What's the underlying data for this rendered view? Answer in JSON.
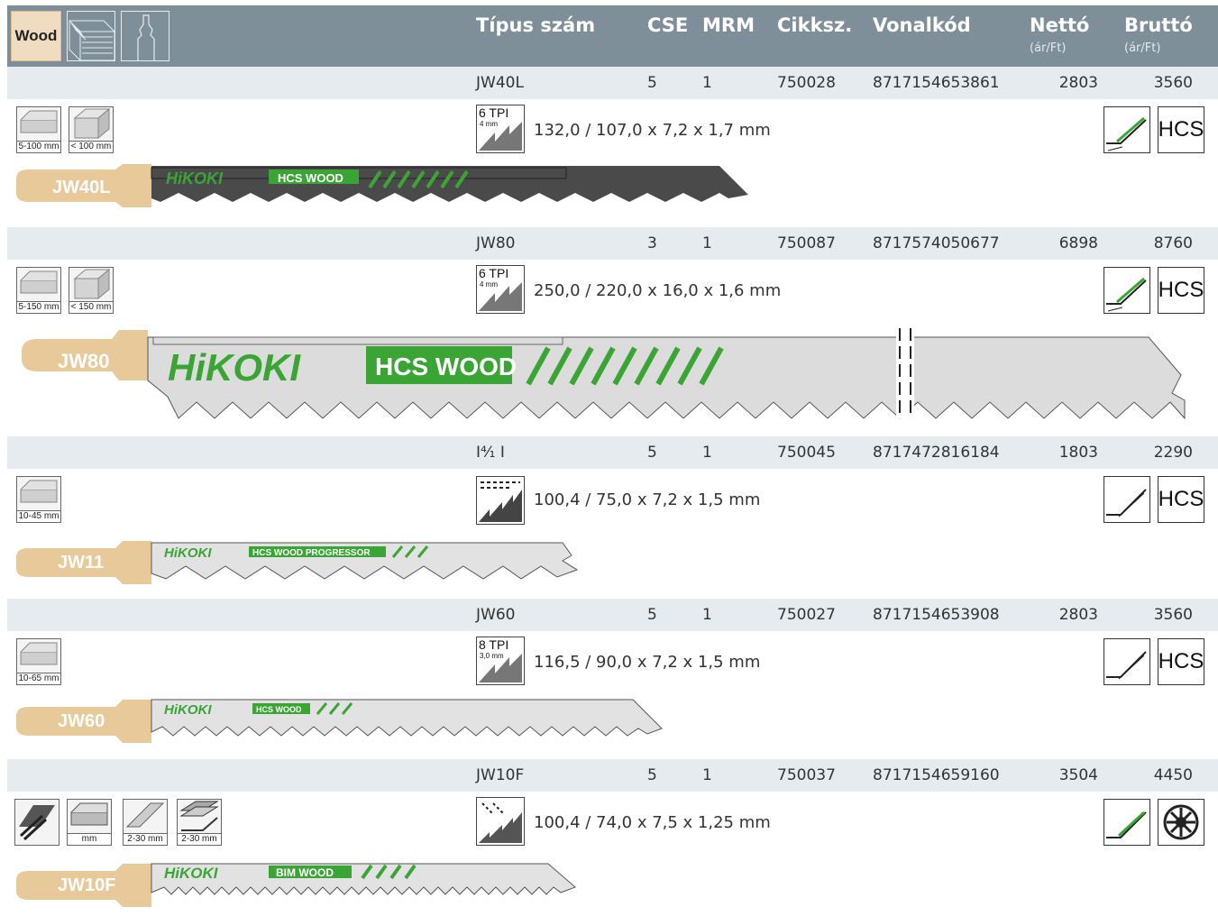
{
  "header": {
    "category": "Wood",
    "columns": {
      "type": "Típus szám",
      "cse": "CSE",
      "mrm": "MRM",
      "article": "Cikksz.",
      "barcode": "Vonalkód",
      "net": "Nettó",
      "net_unit": "(ár/Ft)",
      "gross": "Bruttó",
      "gross_unit": "(ár/Ft)"
    }
  },
  "products": [
    {
      "type": "JW40L",
      "cse": "5",
      "mrm": "1",
      "article": "750028",
      "barcode": "8717154653861",
      "net": "2803",
      "gross": "3560",
      "tpi": "6 TPI",
      "tpi_mm": "4 mm",
      "dims": "132,0 / 107,0 x 7,2 x 1,7 mm",
      "material": "HCS",
      "app_labels": [
        "5-100 mm",
        "< 100 mm"
      ],
      "blade_code": "JW40L",
      "blade_print": [
        "HiKOKI",
        "HCS WOOD"
      ]
    },
    {
      "type": "JW80",
      "cse": "3",
      "mrm": "1",
      "article": "750087",
      "barcode": "8717574050677",
      "net": "6898",
      "gross": "8760",
      "tpi": "6 TPI",
      "tpi_mm": "4 mm",
      "dims": "250,0 / 220,0 x 16,0 x 1,6 mm",
      "material": "HCS",
      "app_labels": [
        "5-150 mm",
        "< 150 mm"
      ],
      "blade_code": "JW80",
      "blade_print": [
        "HiKOKI",
        "HCS WOOD"
      ]
    },
    {
      "type": "I⁴⁄₁ I",
      "cse": "5",
      "mrm": "1",
      "article": "750045",
      "barcode": "8717472816184",
      "net": "1803",
      "gross": "2290",
      "tpi": "",
      "tpi_mm": "",
      "dims": "100,4 / 75,0 x 7,2 x 1,5 mm",
      "material": "HCS",
      "app_labels": [
        "10-45 mm"
      ],
      "blade_code": "JW11",
      "blade_print": [
        "HiKOKI",
        "HCS WOOD PROGRESSOR"
      ]
    },
    {
      "type": "JW60",
      "cse": "5",
      "mrm": "1",
      "article": "750027",
      "barcode": "8717154653908",
      "net": "2803",
      "gross": "3560",
      "tpi": "8 TPI",
      "tpi_mm": "3,0 mm",
      "dims": "116,5 / 90,0 x 7,2 x 1,5 mm",
      "material": "HCS",
      "app_labels": [
        "10-65 mm"
      ],
      "blade_code": "JW60",
      "blade_print": [
        "HiKOKI",
        "HCS WOOD"
      ]
    },
    {
      "type": "JW10F",
      "cse": "5",
      "mrm": "1",
      "article": "750037",
      "barcode": "8717154659160",
      "net": "3504",
      "gross": "4450",
      "tpi": "",
      "tpi_mm": "",
      "dims": "100,4 / 74,0 x 7,5 x 1,25 mm",
      "material": "",
      "app_labels": [
        "",
        "mm",
        "2-30 mm",
        "2-30 mm"
      ],
      "blade_code": "JW10F",
      "blade_print": [
        "HiKOKI",
        "BIM WOOD"
      ]
    }
  ],
  "colors": {
    "header_bg": "#7f8f99",
    "row_bg": "#e5ebee",
    "brand_green": "#3aa535",
    "shank": "#e8c99a"
  },
  "icons": {
    "header": [
      "wood-grain-icon",
      "jigsaw-blade-shank-icon"
    ],
    "cut": "straight-cut-icon"
  }
}
